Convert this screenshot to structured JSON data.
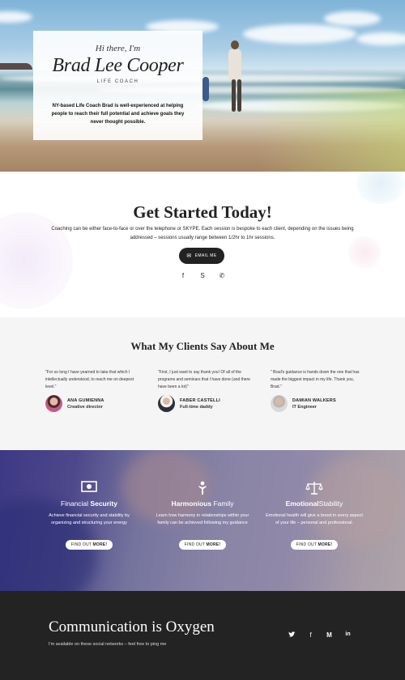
{
  "hero": {
    "greeting": "Hi there, I'm",
    "name": "Brad Lee Cooper",
    "role": "LIFE COACH",
    "description": "NY-based Life Coach Brad is well-experienced at helping people to reach their full potential and achieve goals they never thought possible."
  },
  "get_started": {
    "title_part1": "Get Started",
    "title_bold": "Today",
    "title_end": "!",
    "description": "Coaching can be either face-to-face or over the telephone or SKYPE. Each session is bespoke to each client, depending on the issues being addressed – sessions usually range between 1/2hr to 1hr sessions.",
    "email_button": "EMAIL ME",
    "email_icon": "envelope-icon",
    "social": [
      {
        "name": "facebook-icon",
        "glyph": "f"
      },
      {
        "name": "skype-icon",
        "glyph": "S"
      },
      {
        "name": "whatsapp-icon",
        "glyph": "✆"
      }
    ]
  },
  "testimonials": {
    "title_part1": "What My",
    "title_bold": "Clients",
    "title_end": "Say About Me",
    "items": [
      {
        "quote": "\"For so long I have yearned to take that which I intellectually understood, to reach me on deepest level.\"",
        "name": "ANA GUMIENNA",
        "role": "Creative director"
      },
      {
        "quote": "\"First, I just want to say thank you! Of all of the programs and seminars that I have done (and there have been a lot)\"",
        "name": "FABER CASTELLI",
        "role": "Full-time daddy"
      },
      {
        "quote": "\" Brad's guidance is hands down the one that has made the biggest impact in my life. Thank you, Brad.\"",
        "name": "DAMIAN WALKERS",
        "role": "IT Engineer"
      }
    ]
  },
  "values": {
    "items": [
      {
        "icon": "money-icon",
        "title_part1": "Financial",
        "title_bold": "Security",
        "title_end": "",
        "text": "Achieve financial security and stability by organizing and structuring your energy",
        "button_part1": "FIND OUT",
        "button_bold": "MORE!"
      },
      {
        "icon": "family-icon",
        "title_part1": "",
        "title_bold": "Harmonious",
        "title_end": "Family",
        "text": "Learn how harmony in relationships within your family can be achieved following my guidance",
        "button_part1": "FIND OUT",
        "button_bold": "MORE!"
      },
      {
        "icon": "scales-icon",
        "title_part1": "",
        "title_bold": "Emotional",
        "title_end": "Stability",
        "text": "Emotional health will give a boost in every aspect of your life – personal and professional.",
        "button_part1": "FIND OUT",
        "button_bold": "MORE!"
      }
    ]
  },
  "footer": {
    "title": "Communication is Oxygen",
    "subtitle": "I'm available on these social networks – feel free to ping me",
    "social": [
      {
        "name": "twitter-icon",
        "glyph": "🐦"
      },
      {
        "name": "facebook-icon",
        "glyph": "f"
      },
      {
        "name": "medium-icon",
        "glyph": "M"
      },
      {
        "name": "linkedin-icon",
        "glyph": "in"
      }
    ]
  }
}
